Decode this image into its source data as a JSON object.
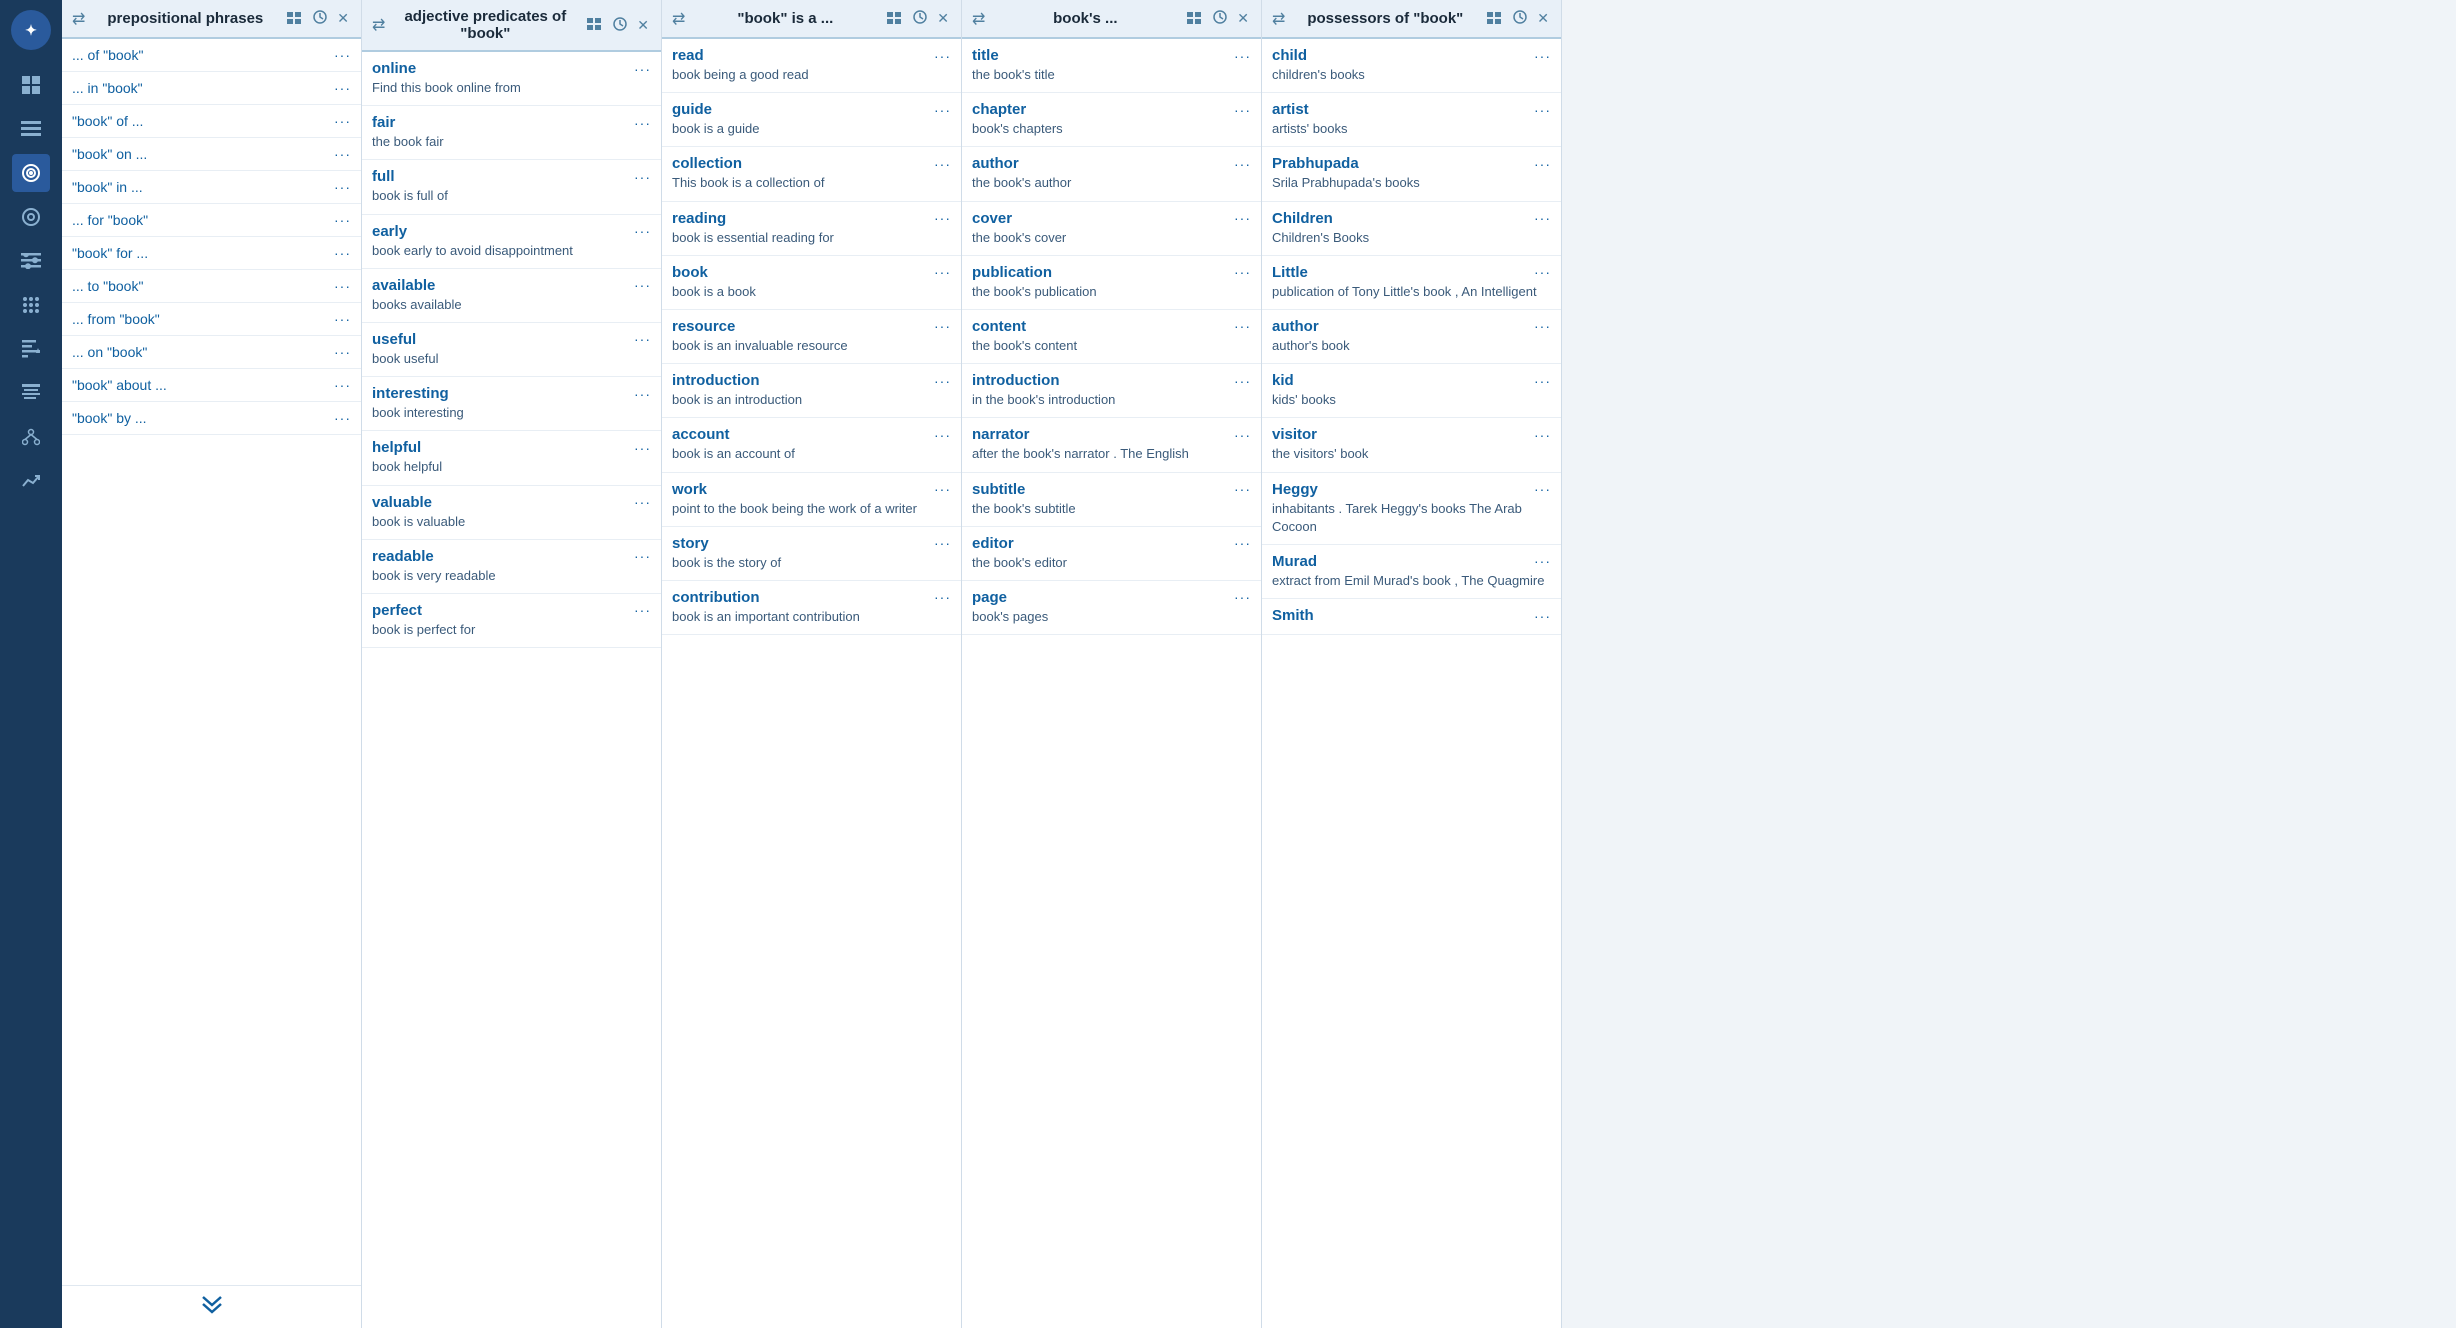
{
  "sidebar": {
    "logo": "✦",
    "items": [
      {
        "name": "grid-icon",
        "icon": "⊞",
        "active": false
      },
      {
        "name": "list-icon",
        "icon": "☰",
        "active": false
      },
      {
        "name": "circle-target-icon",
        "icon": "◎",
        "active": true
      },
      {
        "name": "circle-dot-icon",
        "icon": "⊙",
        "active": false
      },
      {
        "name": "list-bullet-icon",
        "icon": "≡",
        "active": false
      },
      {
        "name": "grid-small-icon",
        "icon": "⋮⋮",
        "active": false
      },
      {
        "name": "arrow-down-list-icon",
        "icon": "↓≡",
        "active": false
      },
      {
        "name": "lines-icon",
        "icon": "≣",
        "active": false
      },
      {
        "name": "graph-icon",
        "icon": "⬡",
        "active": false
      },
      {
        "name": "trend-icon",
        "icon": "↗",
        "active": false
      }
    ]
  },
  "panels": [
    {
      "id": "prepositional-phrases",
      "title": "prepositional phrases",
      "items": [
        {
          "title": "... of \"book\"",
          "dots": "..."
        },
        {
          "title": "... in \"book\"",
          "dots": "..."
        },
        {
          "title": "\"book\" of ...",
          "dots": "..."
        },
        {
          "title": "\"book\" on ...",
          "dots": "..."
        },
        {
          "title": "\"book\" in ...",
          "dots": "..."
        },
        {
          "title": "... for \"book\"",
          "dots": "..."
        },
        {
          "title": "\"book\" for ...",
          "dots": "..."
        },
        {
          "title": "... to \"book\"",
          "dots": "..."
        },
        {
          "title": "... from \"book\"",
          "dots": "..."
        },
        {
          "title": "... on \"book\"",
          "dots": "..."
        },
        {
          "title": "\"book\" about ...",
          "dots": "..."
        },
        {
          "title": "\"book\" by ...",
          "dots": "..."
        }
      ],
      "hasShowMore": true,
      "type": "simple"
    },
    {
      "id": "adjective-predicates",
      "title": "adjective predicates of \"book\"",
      "items": [
        {
          "title": "online",
          "desc": "Find this book online from",
          "dots": "..."
        },
        {
          "title": "fair",
          "desc": "the book fair",
          "dots": "..."
        },
        {
          "title": "full",
          "desc": "book is full of",
          "dots": "..."
        },
        {
          "title": "early",
          "desc": "book early to avoid disappointment",
          "dots": "..."
        },
        {
          "title": "available",
          "desc": "books available",
          "dots": "..."
        },
        {
          "title": "useful",
          "desc": "book useful",
          "dots": "..."
        },
        {
          "title": "interesting",
          "desc": "book interesting",
          "dots": "..."
        },
        {
          "title": "helpful",
          "desc": "book helpful",
          "dots": "..."
        },
        {
          "title": "valuable",
          "desc": "book is valuable",
          "dots": "..."
        },
        {
          "title": "readable",
          "desc": "book is very readable",
          "dots": "..."
        },
        {
          "title": "perfect",
          "desc": "book is perfect for",
          "dots": "..."
        }
      ],
      "hasShowMore": false,
      "type": "entry"
    },
    {
      "id": "book-is-a",
      "title": "\"book\" is a ...",
      "items": [
        {
          "title": "read",
          "desc": "book being a good read",
          "dots": "..."
        },
        {
          "title": "guide",
          "desc": "book is a guide",
          "dots": "..."
        },
        {
          "title": "collection",
          "desc": "This book is a collection of",
          "dots": "..."
        },
        {
          "title": "reading",
          "desc": "book is essential reading for",
          "dots": "..."
        },
        {
          "title": "book",
          "desc": "book is a book",
          "dots": "..."
        },
        {
          "title": "resource",
          "desc": "book is an invaluable resource",
          "dots": "..."
        },
        {
          "title": "introduction",
          "desc": "book is an introduction",
          "dots": "..."
        },
        {
          "title": "account",
          "desc": "book is an account of",
          "dots": "..."
        },
        {
          "title": "work",
          "desc": "point to the book being the work of a writer",
          "dots": "..."
        },
        {
          "title": "story",
          "desc": "book is the story of",
          "dots": "..."
        },
        {
          "title": "contribution",
          "desc": "book is an important contribution",
          "dots": "..."
        }
      ],
      "hasShowMore": false,
      "type": "entry"
    },
    {
      "id": "books",
      "title": "book's ...",
      "items": [
        {
          "title": "title",
          "desc": "the book's title",
          "dots": "..."
        },
        {
          "title": "chapter",
          "desc": "book's chapters",
          "dots": "..."
        },
        {
          "title": "author",
          "desc": "the book's author",
          "dots": "..."
        },
        {
          "title": "cover",
          "desc": "the book's cover",
          "dots": "..."
        },
        {
          "title": "publication",
          "desc": "the book's publication",
          "dots": "..."
        },
        {
          "title": "content",
          "desc": "the book's content",
          "dots": "..."
        },
        {
          "title": "introduction",
          "desc": "in the book's introduction",
          "dots": "..."
        },
        {
          "title": "narrator",
          "desc": "after the book's narrator . The English",
          "dots": "..."
        },
        {
          "title": "subtitle",
          "desc": "the book's subtitle",
          "dots": "..."
        },
        {
          "title": "editor",
          "desc": "the book's editor",
          "dots": "..."
        },
        {
          "title": "page",
          "desc": "book's pages",
          "dots": "..."
        }
      ],
      "hasShowMore": false,
      "type": "entry"
    },
    {
      "id": "possessors-of-book",
      "title": "possessors of \"book\"",
      "items": [
        {
          "title": "child",
          "desc": "children's books",
          "dots": "..."
        },
        {
          "title": "artist",
          "desc": "artists' books",
          "dots": "..."
        },
        {
          "title": "Prabhupada",
          "desc": "Srila Prabhupada's books",
          "dots": "..."
        },
        {
          "title": "Children",
          "desc": "Children's Books",
          "dots": "..."
        },
        {
          "title": "Little",
          "desc": "publication of Tony Little's book , An Intelligent",
          "dots": "..."
        },
        {
          "title": "author",
          "desc": "author's book",
          "dots": "..."
        },
        {
          "title": "kid",
          "desc": "kids' books",
          "dots": "..."
        },
        {
          "title": "visitor",
          "desc": "the visitors' book",
          "dots": "..."
        },
        {
          "title": "Heggy",
          "desc": "inhabitants . Tarek Heggy's books The Arab Cocoon",
          "dots": "..."
        },
        {
          "title": "Murad",
          "desc": "extract from Emil Murad's book , The Quagmire",
          "dots": "..."
        },
        {
          "title": "Smith",
          "desc": "",
          "dots": "..."
        }
      ],
      "hasShowMore": false,
      "type": "entry"
    }
  ],
  "icons": {
    "swap": "⇄",
    "grid_detail": "⊞⊟",
    "clock": "◷",
    "close": "✕",
    "dots_vertical": "⋮",
    "chevron_down": "∨",
    "double_chevron_down": "⋁⋁"
  }
}
